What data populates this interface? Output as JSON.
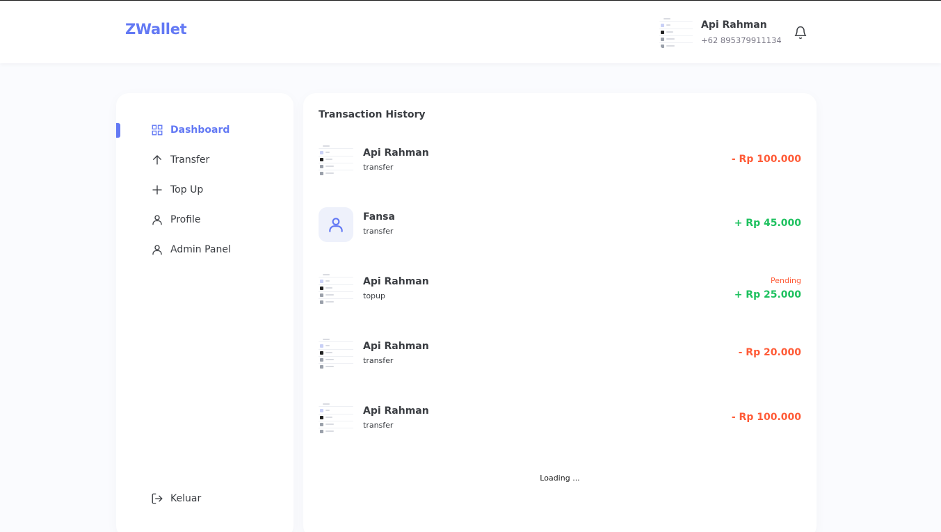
{
  "app": {
    "brand": "ZWallet"
  },
  "header": {
    "user_name": "Api Rahman",
    "user_phone": "+62 895379911134",
    "notification_icon": "bell-icon"
  },
  "sidebar": {
    "items": [
      {
        "label": "Dashboard",
        "icon": "grid-icon",
        "active": true
      },
      {
        "label": "Transfer",
        "icon": "arrow-up-icon",
        "active": false
      },
      {
        "label": "Top Up",
        "icon": "plus-icon",
        "active": false
      },
      {
        "label": "Profile",
        "icon": "user-icon",
        "active": false
      },
      {
        "label": "Admin Panel",
        "icon": "user-icon",
        "active": false
      }
    ],
    "logout_label": "Keluar",
    "logout_icon": "logout-icon"
  },
  "main": {
    "title": "Transaction History",
    "transactions": [
      {
        "name": "Api Rahman",
        "type": "transfer",
        "amount": "- Rp 100.000",
        "direction": "out",
        "status": ""
      },
      {
        "name": "Fansa",
        "type": "transfer",
        "amount": "+ Rp 45.000",
        "direction": "in",
        "status": ""
      },
      {
        "name": "Api Rahman",
        "type": "topup",
        "amount": "+ Rp 25.000",
        "direction": "in",
        "status": "Pending"
      },
      {
        "name": "Api Rahman",
        "type": "transfer",
        "amount": "- Rp 20.000",
        "direction": "out",
        "status": ""
      },
      {
        "name": "Api Rahman",
        "type": "transfer",
        "amount": "- Rp 100.000",
        "direction": "out",
        "status": ""
      }
    ],
    "loading_text": "Loading ..."
  },
  "colors": {
    "accent": "#6379f4",
    "outgoing": "#ff5b37",
    "incoming": "#1ec15f",
    "background": "#fafbfe"
  }
}
